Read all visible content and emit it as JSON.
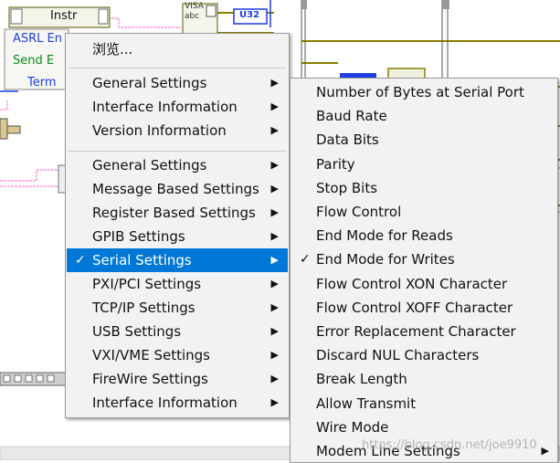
{
  "diagram": {
    "instr_label": "Instr",
    "asrl_label": "ASRL En",
    "send_label": "Send E",
    "term_label": "Term",
    "visa_label": "VISA",
    "visa_sub_label": "abc",
    "u32_label": "U32",
    "colors": {
      "wire_pink": "#ff66cc",
      "wire_olive": "#8a7f00",
      "wire_blue": "#1e3ee6",
      "wire_green": "#0b8a1a"
    }
  },
  "context_menu": {
    "browse_label": "浏览...",
    "items": [
      {
        "label": "General Settings",
        "submenu": true
      },
      {
        "label": "Interface Information",
        "submenu": true
      },
      {
        "label": "Version Information",
        "submenu": true
      },
      {
        "label": "General Settings",
        "submenu": true
      },
      {
        "label": "Message Based Settings",
        "submenu": true
      },
      {
        "label": "Register Based Settings",
        "submenu": true
      },
      {
        "label": "GPIB Settings",
        "submenu": true
      },
      {
        "label": "Serial Settings",
        "submenu": true,
        "checked": true,
        "highlighted": true
      },
      {
        "label": "PXI/PCI Settings",
        "submenu": true
      },
      {
        "label": "TCP/IP Settings",
        "submenu": true
      },
      {
        "label": "USB Settings",
        "submenu": true
      },
      {
        "label": "VXI/VME Settings",
        "submenu": true
      },
      {
        "label": "FireWire Settings",
        "submenu": true
      },
      {
        "label": "Interface Information",
        "submenu": true
      }
    ]
  },
  "serial_submenu": {
    "items": [
      {
        "label": "Number of Bytes at Serial Port"
      },
      {
        "label": "Baud Rate"
      },
      {
        "label": "Data Bits"
      },
      {
        "label": "Parity"
      },
      {
        "label": "Stop Bits"
      },
      {
        "label": "Flow Control"
      },
      {
        "label": "End Mode for Reads"
      },
      {
        "label": "End Mode for Writes",
        "checked": true
      },
      {
        "label": "Flow Control XON Character"
      },
      {
        "label": "Flow Control XOFF Character"
      },
      {
        "label": "Error Replacement Character"
      },
      {
        "label": "Discard NUL Characters"
      },
      {
        "label": "Break Length"
      },
      {
        "label": "Allow Transmit"
      },
      {
        "label": "Wire Mode"
      },
      {
        "label": "Modem Line Settings",
        "submenu": true
      }
    ]
  },
  "symbols": {
    "check": "✓",
    "arrow": "▶"
  },
  "watermark": "https://blog.csdn.net/joe9910"
}
